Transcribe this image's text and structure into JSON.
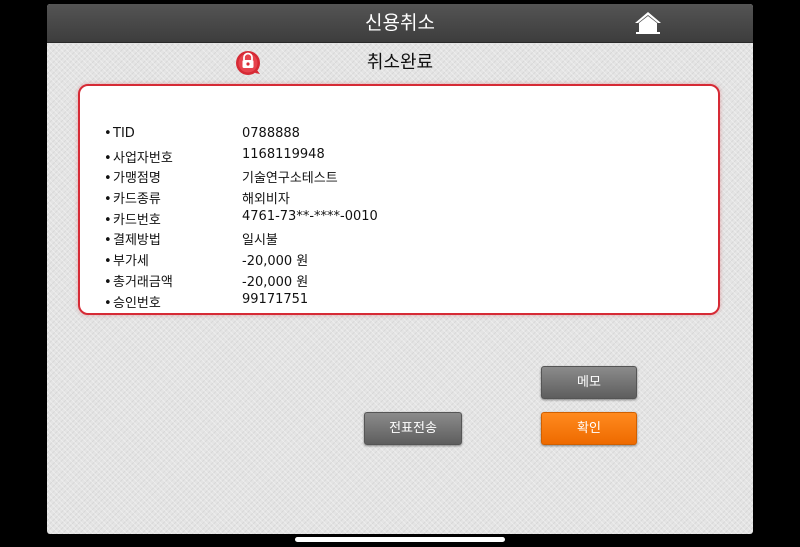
{
  "header": {
    "title": "신용취소",
    "home_icon": "home-icon"
  },
  "subheader": {
    "title": "취소완료",
    "status_icon": "lock-badge-icon",
    "accent": "#d62a35"
  },
  "details": [
    {
      "label": "TID",
      "value": "0788888"
    },
    {
      "label": "사업자번호",
      "value": "1168119948"
    },
    {
      "label": "가맹점명",
      "value": "기술연구소테스트"
    },
    {
      "label": "카드종류",
      "value": "해외비자"
    },
    {
      "label": "카드번호",
      "value": "4761-73**-****-0010"
    },
    {
      "label": "결제방법",
      "value": "일시불"
    },
    {
      "label": "부가세",
      "value": "-20,000 원"
    },
    {
      "label": "총거래금액",
      "value": "-20,000 원"
    },
    {
      "label": "승인번호",
      "value": "99171751"
    }
  ],
  "buttons": {
    "memo": "메모",
    "send_slip": "전표전송",
    "confirm": "확인"
  },
  "colors": {
    "confirm_button": "#f47a12",
    "card_border": "#d62a35"
  }
}
